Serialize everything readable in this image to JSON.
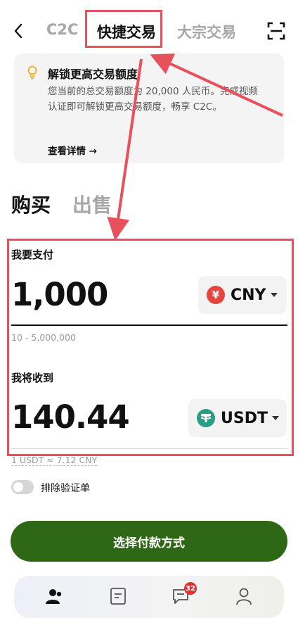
{
  "nav": {
    "tabs": [
      {
        "label": "C2C"
      },
      {
        "label": "快捷交易"
      },
      {
        "label": "大宗交易"
      }
    ]
  },
  "notice": {
    "title": "解锁更高交易额度",
    "body": "您当前的总交易额度为 20,000 人民币。完成视频认证即可解锁更高交易额度，畅享 C2C。",
    "link": "查看详情 →"
  },
  "trade": {
    "buy_label": "购买",
    "sell_label": "出售",
    "pay_label": "我要支付",
    "pay_amount": "1,000",
    "pay_currency": "CNY",
    "pay_currency_symbol": "¥",
    "range": "10 - 5,000,000",
    "receive_label": "我将收到",
    "receive_amount": "140.44",
    "receive_currency": "USDT",
    "rate": "1 USDT ≈ 7.12 CNY"
  },
  "options": {
    "exclude_label": "排除验证单"
  },
  "cta": {
    "label": "选择付款方式"
  },
  "bottom_nav": {
    "badge_count": "32"
  },
  "colors": {
    "accent": "#2e6816",
    "annotation": "#e8505b",
    "cny": "#e5473f",
    "usdt": "#2a9d84"
  }
}
